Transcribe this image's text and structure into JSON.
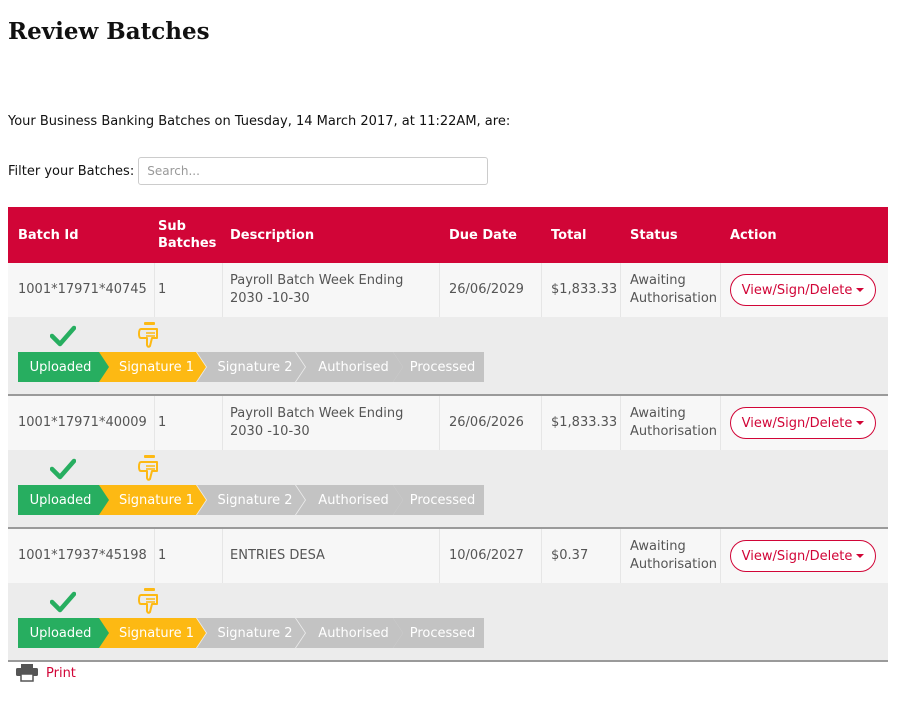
{
  "page": {
    "title": "Review Batches",
    "intro": "Your Business Banking Batches on Tuesday, 14 March 2017, at 11:22AM, are:"
  },
  "filter": {
    "label": "Filter your Batches:",
    "placeholder": "Search..."
  },
  "table": {
    "headers": {
      "batch_id": "Batch Id",
      "sub_batches": "Sub Batches",
      "description": "Description",
      "due_date": "Due Date",
      "total": "Total",
      "status": "Status",
      "action": "Action"
    },
    "rows": [
      {
        "batch_id": "1001*17971*40745",
        "sub_batches": "1",
        "description": "Payroll Batch Week Ending 2030 -10-30",
        "due_date": "26/06/2029",
        "total": "$1,833.33",
        "status": "Awaiting Authorisation",
        "action": "View/Sign/Delete"
      },
      {
        "batch_id": "1001*17971*40009",
        "sub_batches": "1",
        "description": "Payroll Batch Week Ending 2030 -10-30",
        "due_date": "26/06/2026",
        "total": "$1,833.33",
        "status": "Awaiting Authorisation",
        "action": "View/Sign/Delete"
      },
      {
        "batch_id": "1001*17937*45198",
        "sub_batches": "1",
        "description": "ENTRIES DESA",
        "due_date": "10/06/2027",
        "total": "$0.37",
        "status": "Awaiting Authorisation",
        "action": "View/Sign/Delete"
      }
    ]
  },
  "steps": [
    "Uploaded",
    "Signature 1",
    "Signature 2",
    "Authorised",
    "Processed"
  ],
  "step_status": [
    "complete",
    "current",
    "pending",
    "pending",
    "pending"
  ],
  "step_icons": {
    "complete": "checkmark-icon",
    "current": "pointing-hand-icon"
  },
  "colors": {
    "brand": "#d10537",
    "complete": "#27ae60",
    "current": "#fdb913",
    "pending": "#c3c3c3"
  },
  "footer": {
    "print_label": "Print",
    "print_icon": "printer-icon"
  }
}
